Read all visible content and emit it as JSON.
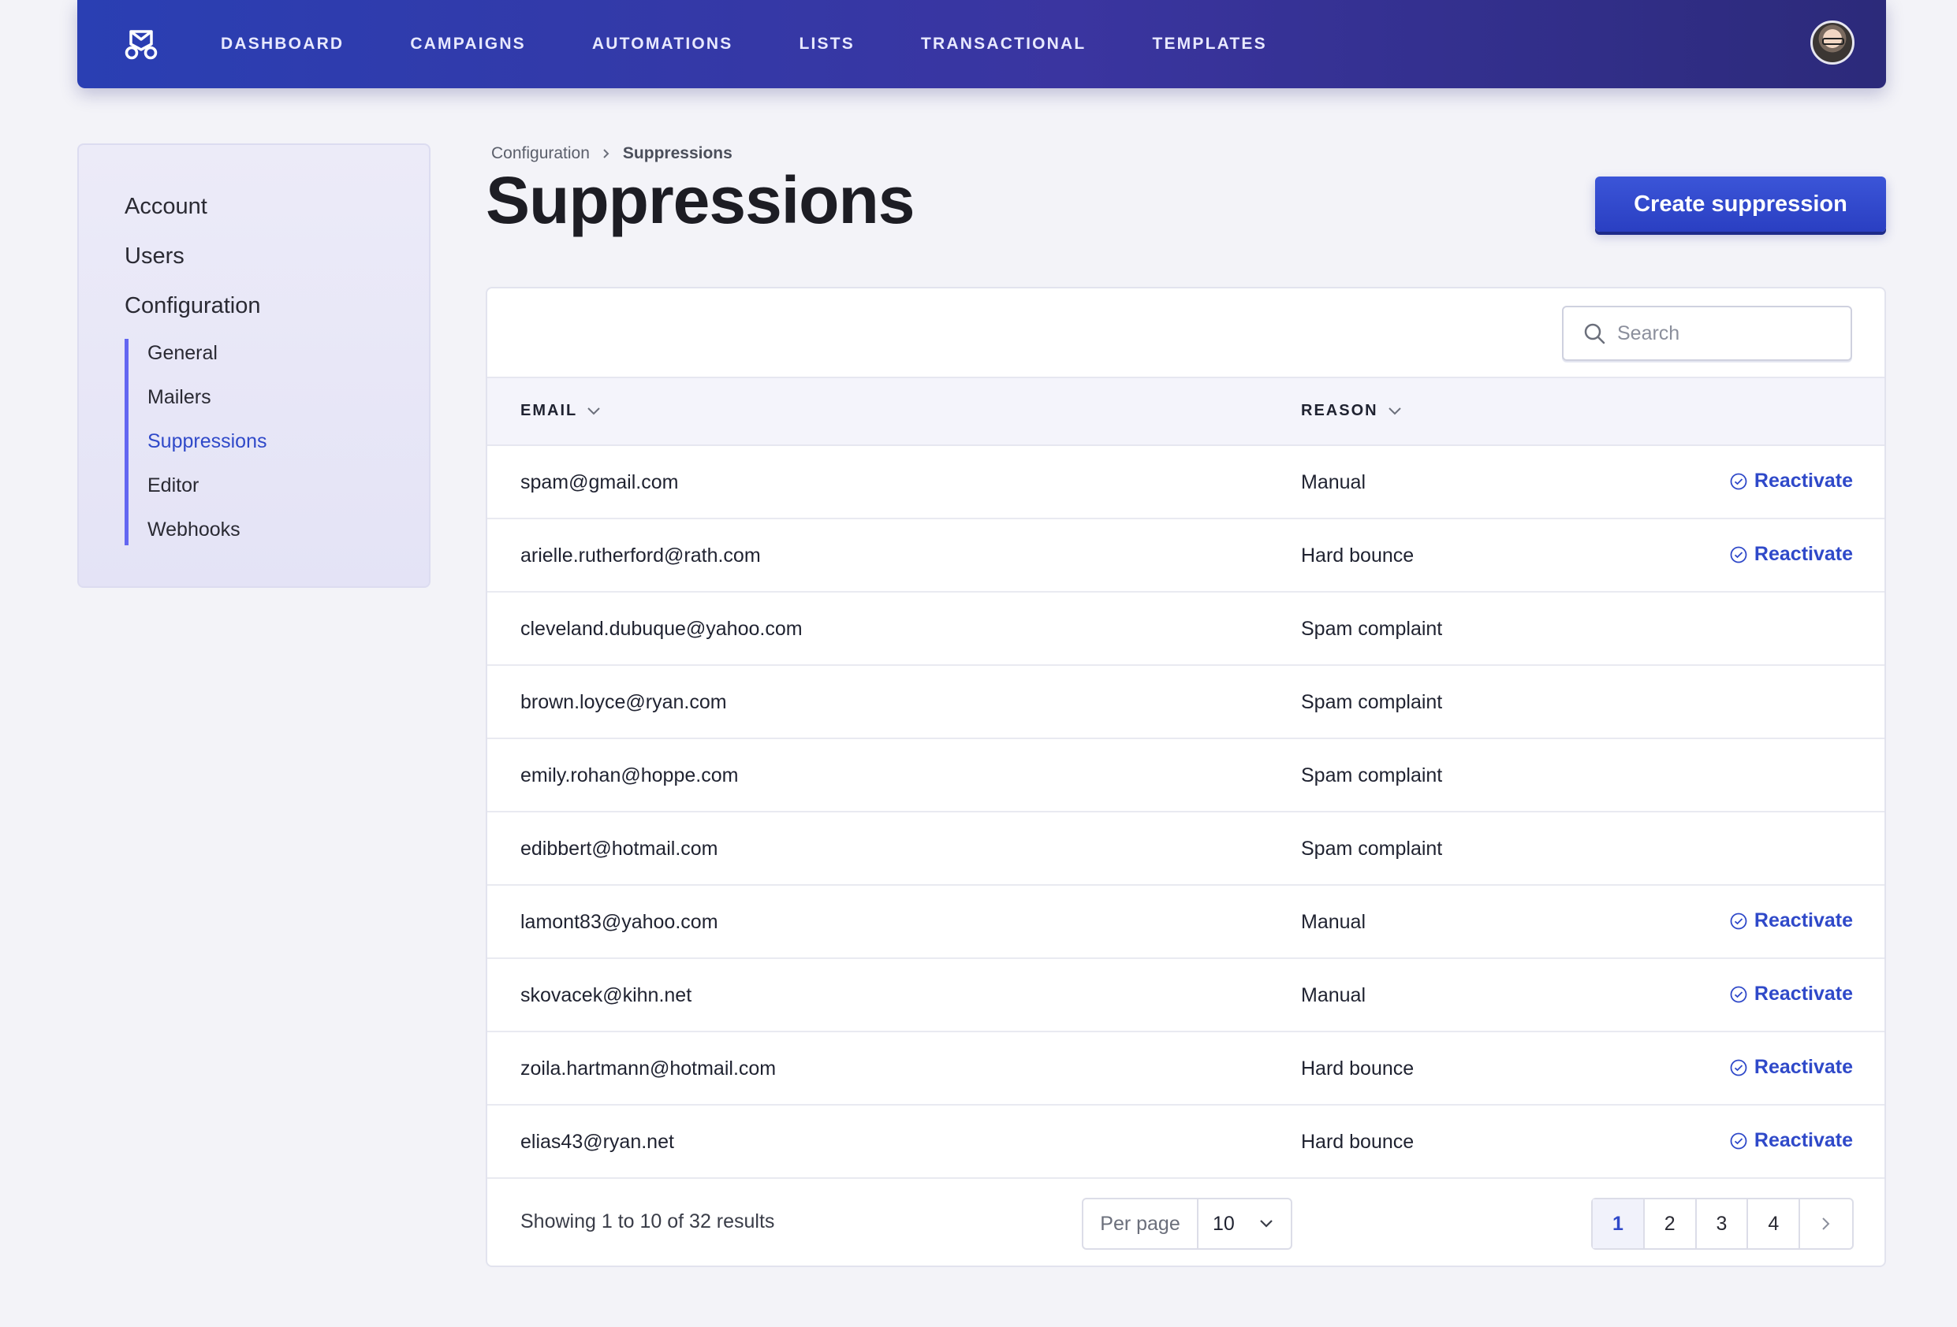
{
  "nav": {
    "items": [
      "DASHBOARD",
      "CAMPAIGNS",
      "AUTOMATIONS",
      "LISTS",
      "TRANSACTIONAL",
      "TEMPLATES"
    ]
  },
  "sidebar": {
    "top_items": [
      "Account",
      "Users",
      "Configuration"
    ],
    "sub_items": [
      "General",
      "Mailers",
      "Suppressions",
      "Editor",
      "Webhooks"
    ],
    "active_sub": "Suppressions"
  },
  "breadcrumb": {
    "parent": "Configuration",
    "current": "Suppressions"
  },
  "page": {
    "title": "Suppressions",
    "create_button": "Create suppression"
  },
  "search": {
    "placeholder": "Search",
    "value": ""
  },
  "table": {
    "columns": [
      "EMAIL",
      "REASON"
    ],
    "action_label": "Reactivate",
    "rows": [
      {
        "email": "spam@gmail.com",
        "reason": "Manual",
        "action": true
      },
      {
        "email": "arielle.rutherford@rath.com",
        "reason": "Hard bounce",
        "action": true
      },
      {
        "email": "cleveland.dubuque@yahoo.com",
        "reason": "Spam complaint",
        "action": false
      },
      {
        "email": "brown.loyce@ryan.com",
        "reason": "Spam complaint",
        "action": false
      },
      {
        "email": "emily.rohan@hoppe.com",
        "reason": "Spam complaint",
        "action": false
      },
      {
        "email": "edibbert@hotmail.com",
        "reason": "Spam complaint",
        "action": false
      },
      {
        "email": "lamont83@yahoo.com",
        "reason": "Manual",
        "action": true
      },
      {
        "email": "skovacek@kihn.net",
        "reason": "Manual",
        "action": true
      },
      {
        "email": "zoila.hartmann@hotmail.com",
        "reason": "Hard bounce",
        "action": true
      },
      {
        "email": "elias43@ryan.net",
        "reason": "Hard bounce",
        "action": true
      }
    ]
  },
  "footer": {
    "results_text": "Showing 1 to 10 of 32 results",
    "per_page_label": "Per page",
    "per_page_value": "10",
    "pages": [
      "1",
      "2",
      "3",
      "4"
    ],
    "current_page": "1"
  },
  "colors": {
    "accent": "#2f49c9",
    "nav_start": "#2a3fb3",
    "nav_end": "#2c2a7a",
    "sidebar_marker": "#6366f1"
  }
}
